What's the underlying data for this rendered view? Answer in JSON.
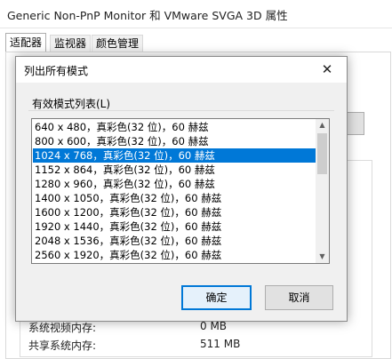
{
  "parent": {
    "title": "Generic Non-PnP Monitor 和 VMware SVGA 3D 属性",
    "tabs": [
      {
        "label": "适配器"
      },
      {
        "label": "监视器"
      },
      {
        "label": "颜色管理"
      }
    ],
    "memory_rows": [
      {
        "label": "系统视频内存:",
        "value": "0 MB"
      },
      {
        "label": "共享系统内存:",
        "value": "511 MB"
      }
    ]
  },
  "dialog": {
    "title": "列出所有模式",
    "group_label": "有效模式列表(L)",
    "modes": [
      "640 x 480，真彩色(32 位)，60 赫兹",
      "800 x 600，真彩色(32 位)，60 赫兹",
      "1024 x 768，真彩色(32 位)，60 赫兹",
      "1152 x 864，真彩色(32 位)，60 赫兹",
      "1280 x 960，真彩色(32 位)，60 赫兹",
      "1400 x 1050，真彩色(32 位)，60 赫兹",
      "1600 x 1200，真彩色(32 位)，60 赫兹",
      "1920 x 1440，真彩色(32 位)，60 赫兹",
      "2048 x 1536，真彩色(32 位)，60 赫兹",
      "2560 x 1920，真彩色(32 位)，60 赫兹"
    ],
    "selected_index": 2,
    "ok_label": "确定",
    "cancel_label": "取消",
    "close_glyph": "✕"
  },
  "colors": {
    "selection": "#0078d7",
    "dialog_bg": "#f0f0f0"
  }
}
